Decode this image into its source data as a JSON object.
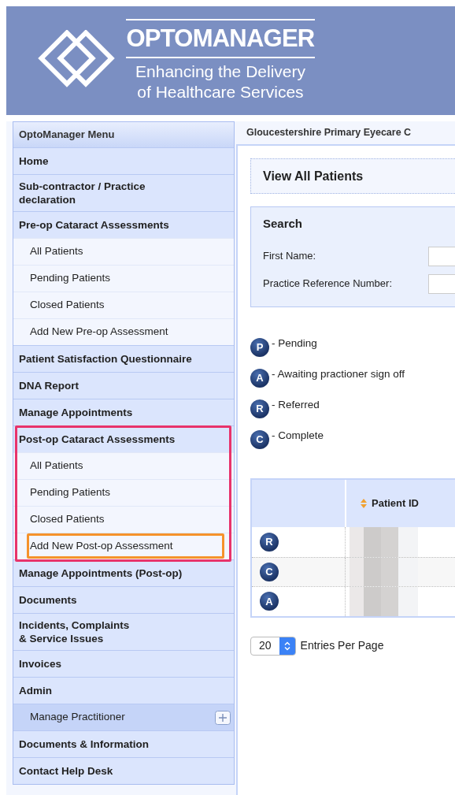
{
  "header": {
    "brand": "OPTOMANAGER",
    "tagline_lines": [
      "Enhancing the Delivery",
      "of Healthcare Services"
    ]
  },
  "menu": {
    "title": "OptoManager Menu",
    "sections": [
      {
        "label": "Home",
        "outlined": false
      },
      {
        "label": "Sub-contractor / Practice\ndeclaration",
        "outlined": false
      },
      {
        "label": "Pre-op Cataract Assessments",
        "outlined": false,
        "children": [
          {
            "label": "All Patients",
            "selected": false,
            "outlined": false
          },
          {
            "label": "Pending Patients",
            "selected": false,
            "outlined": false
          },
          {
            "label": "Closed Patients",
            "selected": false,
            "outlined": false
          },
          {
            "label": "Add New Pre-op Assessment",
            "selected": false,
            "outlined": false
          }
        ]
      },
      {
        "label": "Patient Satisfaction Questionnaire",
        "outlined": false
      },
      {
        "label": "DNA Report",
        "outlined": false
      },
      {
        "label": "Manage Appointments",
        "outlined": false
      },
      {
        "label": "Post-op Cataract Assessments",
        "outlined": true,
        "children": [
          {
            "label": "All Patients",
            "selected": false,
            "outlined": false
          },
          {
            "label": "Pending Patients",
            "selected": false,
            "outlined": false
          },
          {
            "label": "Closed Patients",
            "selected": false,
            "outlined": false
          },
          {
            "label": "Add New Post-op Assessment",
            "selected": false,
            "outlined": true
          }
        ]
      },
      {
        "label": "Manage Appointments (Post-op)",
        "outlined": false
      },
      {
        "label": "Documents",
        "outlined": false
      },
      {
        "label": "Incidents, Complaints\n& Service Issues",
        "outlined": false
      },
      {
        "label": "Invoices",
        "outlined": false
      },
      {
        "label": "Admin",
        "outlined": false,
        "children": [
          {
            "label": "Manage Practitioner",
            "selected": true,
            "outlined": false
          }
        ]
      },
      {
        "label": "Documents & Information",
        "outlined": false
      },
      {
        "label": "Contact Help Desk",
        "outlined": false
      }
    ]
  },
  "breadcrumb": "Gloucestershire Primary Eyecare C",
  "page_title": "View All Patients",
  "search": {
    "title": "Search",
    "fields": [
      {
        "label": "First Name:"
      },
      {
        "label": "Practice Reference Number:"
      }
    ]
  },
  "legend": [
    {
      "letter": "P",
      "label": "- Pending"
    },
    {
      "letter": "A",
      "label": "- Awaiting practioner sign off"
    },
    {
      "letter": "R",
      "label": "- Referred"
    },
    {
      "letter": "C",
      "label": "- Complete"
    }
  ],
  "table": {
    "columns": [
      {
        "label": "Patient ID",
        "sortable": true
      }
    ],
    "rows": [
      {
        "status": "R"
      },
      {
        "status": "C"
      },
      {
        "status": "A"
      }
    ]
  },
  "paging": {
    "value": "20",
    "label": "Entries Per Page"
  }
}
